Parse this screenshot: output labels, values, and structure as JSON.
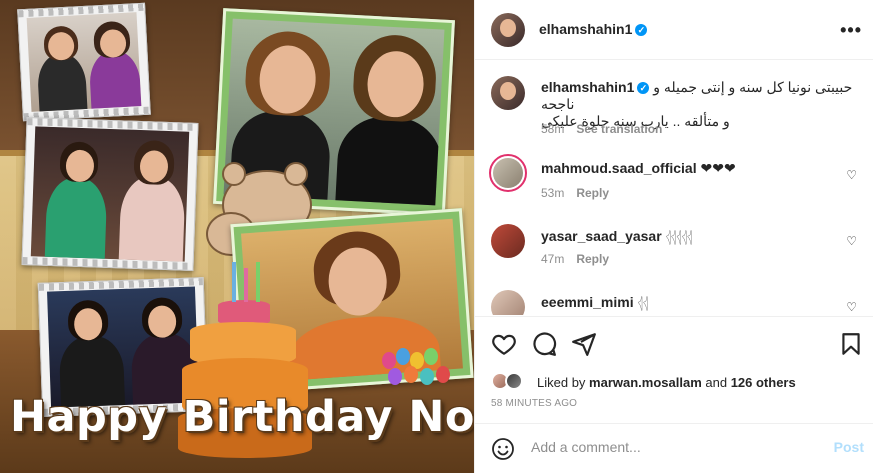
{
  "post_image": {
    "banner_text": "Happy Birthday Noneya"
  },
  "header": {
    "username": "elhamshahin1",
    "verified_mark": "✓",
    "more_label": "•••"
  },
  "caption": {
    "username": "elhamshahin1",
    "text_line1": "حبيبتى نونيا كل سنه و إنتى جميله و ناجحه",
    "text_line2": "و متألقه .. يارب سنه حلوة عليكى",
    "time": "58m",
    "see_translation": "See translation"
  },
  "comments": [
    {
      "username": "mahmoud.saad_official",
      "text": "❤❤❤",
      "time": "53m",
      "reply": "Reply"
    },
    {
      "username": "yasar_saad_yasar",
      "text": "𓂆𓂆𓂆𓂆𓂆",
      "time": "47m",
      "reply": "Reply"
    },
    {
      "username": "eeemmi_mimi",
      "text": "𓂆𓂆",
      "time": "",
      "reply": ""
    }
  ],
  "likes": {
    "prefix": "Liked by ",
    "user": "marwan.mosallam",
    "middle": " and ",
    "others": "126 others"
  },
  "timestamp": "58 MINUTES AGO",
  "add_comment": {
    "placeholder": "Add a comment...",
    "post_label": "Post"
  },
  "icons": {
    "like": "heart-icon",
    "comment": "comment-icon",
    "share": "share-icon",
    "save": "bookmark-icon",
    "emoji": "emoji-icon"
  },
  "colors": {
    "verified": "#0095f6",
    "post_disabled": "#b2dffc",
    "story_ring": "#e1306c"
  }
}
